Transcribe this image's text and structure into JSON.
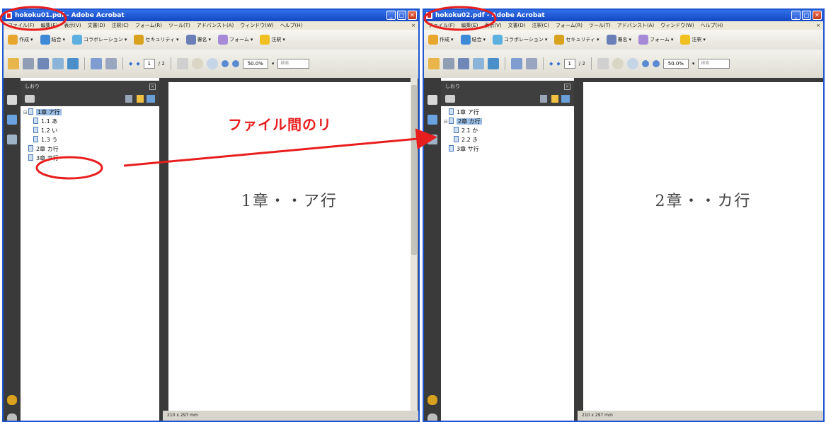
{
  "windows": [
    {
      "title": "hokoku01.pdf - Adobe Acrobat",
      "menus": [
        "ファイル(F)",
        "編集(E)",
        "表示(V)",
        "文書(D)",
        "注釈(C)",
        "フォーム(R)",
        "ツール(T)",
        "アドバンスト(A)",
        "ウィンドウ(W)",
        "ヘルプ(H)"
      ],
      "task_buttons": [
        "作成",
        "結合",
        "コラボレーション",
        "セキュリティ",
        "署名",
        "フォーム",
        "注釈"
      ],
      "page_number": "1",
      "page_total": "/ 2",
      "zoom": "50.0%",
      "search_placeholder": "検索",
      "bookmarks_title": "しおり",
      "bookmarks": [
        {
          "label": "1章 ア行",
          "selected": true
        },
        {
          "label": "1.1 あ"
        },
        {
          "label": "1.2 い"
        },
        {
          "label": "1.3 う"
        },
        {
          "label": "2章 カ行",
          "selected": false
        },
        {
          "label": "3章 サ行"
        }
      ],
      "page_text": "1章・・ア行",
      "status_text": "210 x 297 mm"
    },
    {
      "title": "hokoku02.pdf - Adobe Acrobat",
      "menus": [
        "ファイル(F)",
        "編集(E)",
        "表示(V)",
        "文書(D)",
        "注釈(C)",
        "フォーム(R)",
        "ツール(T)",
        "アドバンスト(A)",
        "ウィンドウ(W)",
        "ヘルプ(H)"
      ],
      "task_buttons": [
        "作成",
        "結合",
        "コラボレーション",
        "セキュリティ",
        "署名",
        "フォーム",
        "注釈"
      ],
      "page_number": "1",
      "page_total": "/ 2",
      "zoom": "50.0%",
      "search_placeholder": "検索",
      "bookmarks_title": "しおり",
      "bookmarks": [
        {
          "label": "1章 ア行"
        },
        {
          "label": "2章 カ行",
          "selected": true
        },
        {
          "label": "2.1 か"
        },
        {
          "label": "2.2 き"
        },
        {
          "label": "3章 サ行"
        }
      ],
      "page_text": "2章・・カ行",
      "status_text": "210 x 297 mm"
    }
  ],
  "annotation": {
    "text": "ファイル間のリ",
    "color": "#e81e1e"
  },
  "colors": {
    "titlebar": "#1e56d0",
    "annotation_red": "#e81e1e",
    "bookmark_selected": "#99bde4"
  }
}
